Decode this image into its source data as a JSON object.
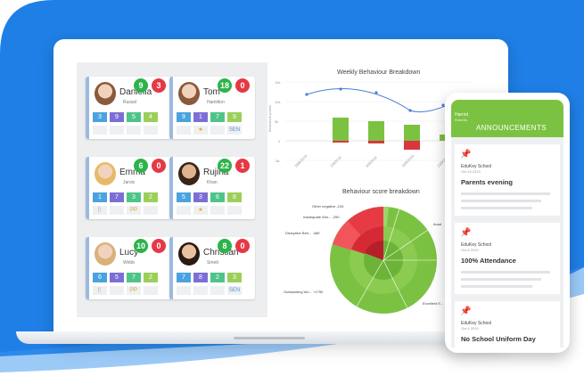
{
  "students": [
    {
      "first": "Daniella",
      "last": "Russel",
      "green": "9",
      "red": "3",
      "tiles": [
        "3",
        "9",
        "5",
        "4"
      ],
      "icons": [
        "",
        "",
        "",
        ""
      ]
    },
    {
      "first": "Tom",
      "last": "Hamilton",
      "green": "18",
      "red": "0",
      "tiles": [
        "9",
        "1",
        "7",
        "9"
      ],
      "icons": [
        "",
        "★",
        "",
        "SEN"
      ]
    },
    {
      "first": "Emma",
      "last": "Jarvis",
      "green": "6",
      "red": "0",
      "tiles": [
        "1",
        "7",
        "3",
        "2"
      ],
      "icons": [
        "🍴",
        "",
        "PP",
        ""
      ]
    },
    {
      "first": "Rujina",
      "last": "Khan",
      "green": "22",
      "red": "1",
      "tiles": [
        "5",
        "3",
        "6",
        "8"
      ],
      "icons": [
        "",
        "★",
        "",
        ""
      ]
    },
    {
      "first": "Lucy",
      "last": "Webb",
      "green": "10",
      "red": "0",
      "tiles": [
        "6",
        "5",
        "7",
        "2"
      ],
      "icons": [
        "🍴",
        "",
        "PP",
        ""
      ]
    },
    {
      "first": "Christian",
      "last": "Smett",
      "green": "8",
      "red": "0",
      "tiles": [
        "7",
        "8",
        "2",
        "3"
      ],
      "icons": [
        "",
        "",
        "",
        "SEN"
      ]
    }
  ],
  "charts": {
    "weekly_title": "Weekly Behaviour Breakdown",
    "breakdown_title": "Behaviour score breakdown",
    "y_axis_label": "Behaviour points",
    "y_ticks": [
      "15k",
      "10k",
      "5k",
      "0",
      "-5k"
    ],
    "x_ticks": [
      "26/8/2019",
      "2/9/2019",
      "9/9/2019",
      "16/9/2019",
      "23/9/2019"
    ],
    "pie_labels": {
      "other_negative": "Other negative -243",
      "inadequate_wo": "Inadequate Wor... -250",
      "disruptive": "Disruptive Beh... -466",
      "outstanding": "Outstanding Wo... +1750",
      "excellent": "Excellent E...",
      "acad": "Acad"
    }
  },
  "phone": {
    "user_name": "Harriot",
    "user_sub": "Roberts",
    "header": "ANNOUNCEMENTS",
    "announcements": [
      {
        "school": "EduKey School",
        "date": "Oct 15 2019",
        "title": "Parents evening"
      },
      {
        "school": "EduKey School",
        "date": "Oct 8 2019",
        "title": "100% Attendance"
      },
      {
        "school": "EduKey School",
        "date": "Oct 4 2019",
        "title": "No School Uniform Day"
      }
    ]
  },
  "colors": {
    "brand_blue": "#1f7fe6",
    "green": "#7cc242",
    "badge_green": "#2cb34a",
    "badge_red": "#e53945"
  }
}
